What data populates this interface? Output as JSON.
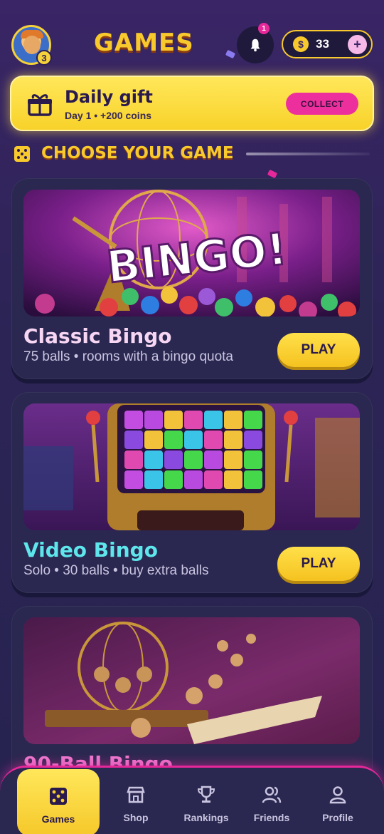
{
  "header": {
    "title": "GAMES",
    "avatar_level": "3",
    "notification_count": "1",
    "coins": "33",
    "add_coins_label": "+"
  },
  "daily_gift": {
    "title": "Daily gift",
    "subtitle": "Day 1 • +200 coins",
    "collect_label": "COLLECT"
  },
  "section": {
    "title": "CHOOSE YOUR GAME"
  },
  "games": [
    {
      "name": "Classic Bingo",
      "description": "75 balls • rooms with a bingo quota",
      "play_label": "PLAY",
      "image_text": "BINGO!",
      "name_color": "#f7d6f3"
    },
    {
      "name": "Video Bingo",
      "description": "Solo • 30 balls • buy extra balls",
      "play_label": "PLAY",
      "image_text": "",
      "name_color": "#5ee6ec"
    },
    {
      "name": "90-Ball Bingo",
      "description": "",
      "play_label": "",
      "image_text": "",
      "name_color": "#ec7ad0"
    }
  ],
  "nav": {
    "items": [
      {
        "label": "Games",
        "icon": "dice-icon",
        "active": true
      },
      {
        "label": "Shop",
        "icon": "shop-icon",
        "active": false
      },
      {
        "label": "Rankings",
        "icon": "trophy-icon",
        "active": false
      },
      {
        "label": "Friends",
        "icon": "friends-icon",
        "active": false
      },
      {
        "label": "Profile",
        "icon": "profile-icon",
        "active": false
      }
    ]
  },
  "colors": {
    "accent_yellow": "#f8c92c",
    "accent_pink": "#e6289a",
    "background": "#2c2455"
  }
}
